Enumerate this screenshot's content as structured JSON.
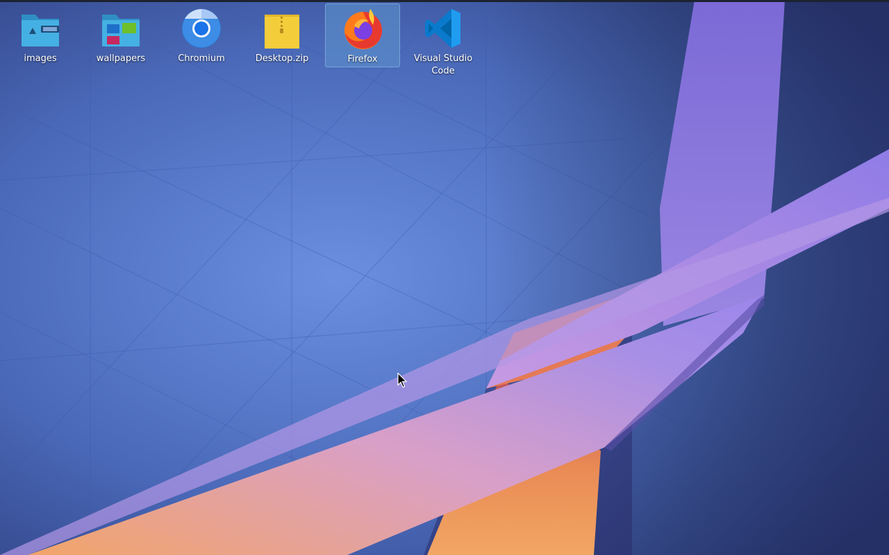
{
  "desktop": {
    "icons": [
      {
        "label": "images",
        "icon": "folder-images-icon",
        "selected": false
      },
      {
        "label": "wallpapers",
        "icon": "folder-wallpapers-icon",
        "selected": false
      },
      {
        "label": "Chromium",
        "icon": "chromium-icon",
        "selected": false
      },
      {
        "label": "Desktop.zip",
        "icon": "zip-archive-icon",
        "selected": false
      },
      {
        "label": "Firefox",
        "icon": "firefox-icon",
        "selected": true
      },
      {
        "label": "Visual Studio Code",
        "icon": "vscode-icon",
        "selected": false
      }
    ]
  },
  "colors": {
    "background_blue": "#4f6fbd",
    "ribbon_purple": "#8b7ce0",
    "ribbon_orange": "#f0a070",
    "selection": "#5f96cd",
    "folder_blue": "#3fa8d8",
    "zip_yellow": "#f5d044",
    "vscode_blue": "#0a7acc"
  }
}
